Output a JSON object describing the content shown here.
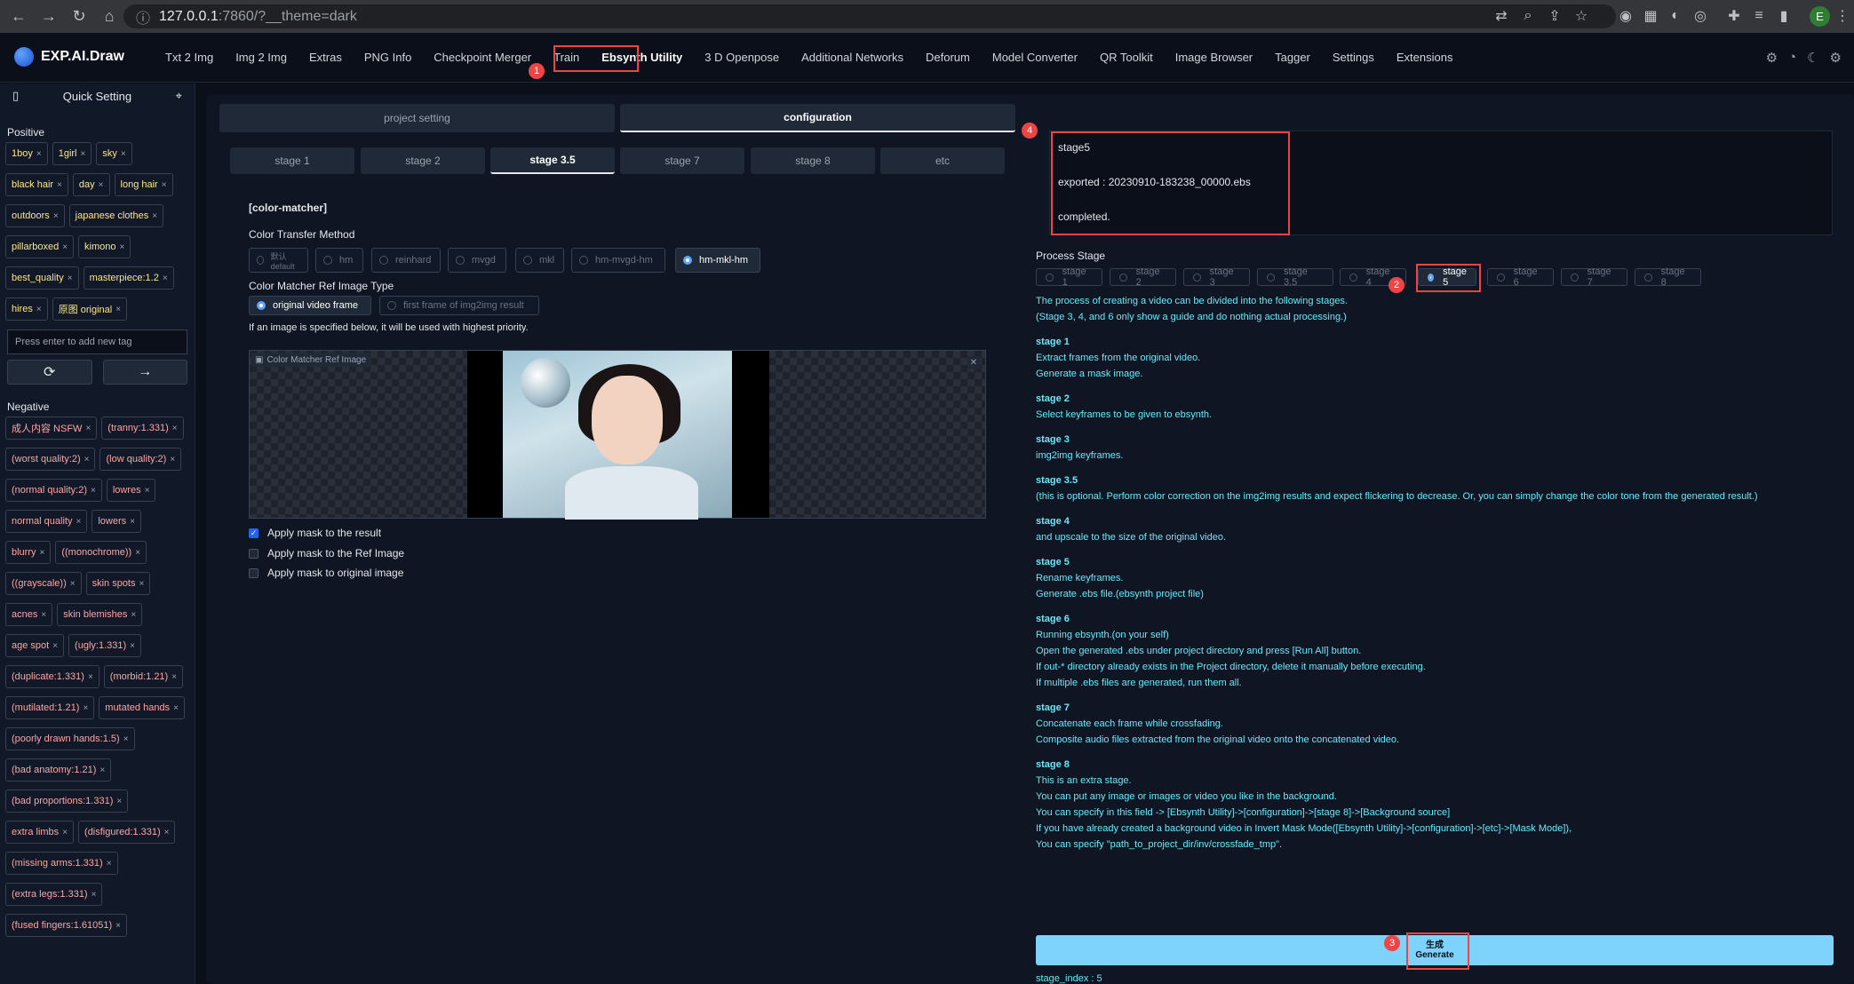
{
  "browser": {
    "url_host": "127.0.0.1",
    "url_rest": ":7860/?__theme=dark",
    "profile": "E"
  },
  "app": {
    "brand": "EXP.AI.Draw",
    "tabs": [
      "Txt 2 Img",
      "Img 2 Img",
      "Extras",
      "PNG Info",
      "Checkpoint Merger",
      "Train",
      "Ebsynth Utility",
      "3 D Openpose",
      "Additional Networks",
      "Deforum",
      "Model Converter",
      "QR Toolkit",
      "Image Browser",
      "Tagger",
      "Settings",
      "Extensions"
    ]
  },
  "sidebar": {
    "title": "Quick Setting",
    "positive_label": "Positive",
    "positive_tags": [
      "1boy",
      "1girl",
      "sky",
      "black hair",
      "day",
      "long hair",
      "outdoors",
      "japanese clothes",
      "pillarboxed",
      "kimono",
      "best_quality",
      "masterpiece:1.2",
      "hires",
      "原图 original"
    ],
    "tag_placeholder": "Press enter to add new tag",
    "negative_label": "Negative",
    "negative_tags": [
      "成人内容 NSFW",
      "(tranny:1.331)",
      "(worst quality:2)",
      "(low quality:2)",
      "(normal quality:2)",
      "lowres",
      "normal quality",
      "lowers",
      "blurry",
      "((monochrome))",
      "((grayscale))",
      "skin spots",
      "acnes",
      "skin blemishes",
      "age spot",
      "(ugly:1.331)",
      "(duplicate:1.331)",
      "(morbid:1.21)",
      "(mutilated:1.21)",
      "mutated hands",
      "(poorly drawn hands:1.5)",
      "(bad anatomy:1.21)",
      "(bad proportions:1.331)",
      "extra limbs",
      "(disfigured:1.331)",
      "(missing arms:1.331)",
      "(extra legs:1.331)",
      "(fused fingers:1.61051)"
    ]
  },
  "main": {
    "top_tabs": [
      "project setting",
      "configuration"
    ],
    "stage_tabs": [
      "stage 1",
      "stage 2",
      "stage 3.5",
      "stage 7",
      "stage 8",
      "etc"
    ],
    "section_title": "[color-matcher]",
    "ctm_label": "Color Transfer Method",
    "ctm_options": [
      "默认 default",
      "hm",
      "reinhard",
      "mvgd",
      "mkl",
      "hm-mvgd-hm",
      "hm-mkl-hm"
    ],
    "ref_type_label": "Color Matcher Ref Image Type",
    "ref_type_options": [
      "original video frame",
      "first frame of img2img result"
    ],
    "priority_note": "If an image is specified below, it will be used with highest priority.",
    "image_label": "Color Matcher Ref Image",
    "checkboxes": [
      "Apply mask to the result",
      "Apply mask to the Ref Image",
      "Apply mask to original image"
    ]
  },
  "output": {
    "line1": "stage5",
    "line2": "exported : 20230910-183238_00000.ebs",
    "line3": "completed."
  },
  "process": {
    "label": "Process Stage",
    "stages": [
      "stage 1",
      "stage 2",
      "stage 3",
      "stage 3.5",
      "stage 4",
      "stage 5",
      "stage 6",
      "stage 7",
      "stage 8"
    ],
    "intro1": "The process of creating a video can be divided into the following stages.",
    "intro2": "(Stage 3, 4, and 6 only show a guide and do nothing actual processing.)",
    "s1h": "stage 1",
    "s1a": "Extract frames from the original video.",
    "s1b": "Generate a mask image.",
    "s2h": "stage 2",
    "s2a": "Select keyframes to be given to ebsynth.",
    "s3h": "stage 3",
    "s3a": "img2img keyframes.",
    "s35h": "stage 3.5",
    "s35a": "(this is optional. Perform color correction on the img2img results and expect flickering to decrease. Or, you can simply change the color tone from the generated result.)",
    "s4h": "stage 4",
    "s4a": "and upscale to the size of the original video.",
    "s5h": "stage 5",
    "s5a": "Rename keyframes.",
    "s5b": "Generate .ebs file.(ebsynth project file)",
    "s6h": "stage 6",
    "s6a": "Running ebsynth.(on your self)",
    "s6b": "Open the generated .ebs under project directory and press [Run All] button.",
    "s6c": "If out-* directory already exists in the Project directory, delete it manually before executing.",
    "s6d": "If multiple .ebs files are generated, run them all.",
    "s7h": "stage 7",
    "s7a": "Concatenate each frame while crossfading.",
    "s7b": "Composite audio files extracted from the original video onto the concatenated video.",
    "s8h": "stage 8",
    "s8a": "This is an extra stage.",
    "s8b": "You can put any image or images or video you like in the background.",
    "s8c": "You can specify in this field -> [Ebsynth Utility]->[configuration]->[stage 8]->[Background source]",
    "s8d": "If you have already created a background video in Invert Mask Mode([Ebsynth Utility]->[configuration]->[etc]->[Mask Mode]),",
    "s8e": "You can specify \"path_to_project_dir/inv/crossfade_tmp\".",
    "gen1": "生成",
    "gen2": "Generate",
    "stage_index": "stage_index : 5"
  },
  "markers": [
    "1",
    "2",
    "3",
    "4"
  ]
}
